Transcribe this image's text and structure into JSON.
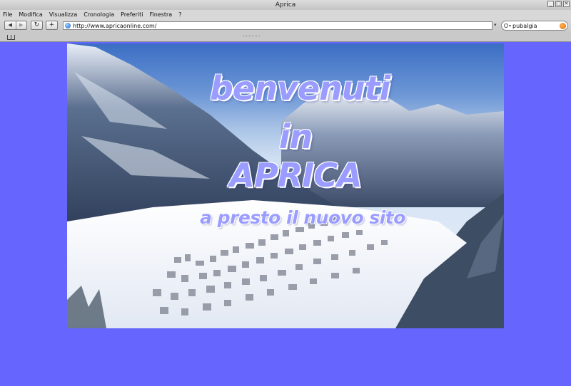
{
  "window": {
    "title": "Aprica",
    "controls": [
      "_",
      "□",
      "✕"
    ]
  },
  "menubar": {
    "items": [
      "File",
      "Modifica",
      "Visualizza",
      "Cronologia",
      "Preferiti",
      "Finestra",
      "?"
    ]
  },
  "toolbar": {
    "back_glyph": "◀",
    "forward_glyph": "▶",
    "reload_glyph": "↻",
    "add_glyph": "+",
    "url": "http://www.apricaonline.com/",
    "search_value": "pubalgia"
  },
  "icons": {
    "bookmarks": "book-icon",
    "url": "globe-icon",
    "search": "search-icon",
    "clear": "clear-search-icon"
  },
  "page": {
    "background_color": "#6666ff",
    "headline_line1": "benvenuti",
    "headline_line2": "in APRICA",
    "subline": "a presto il nuovo sito",
    "text_color": "#9a9cff"
  }
}
